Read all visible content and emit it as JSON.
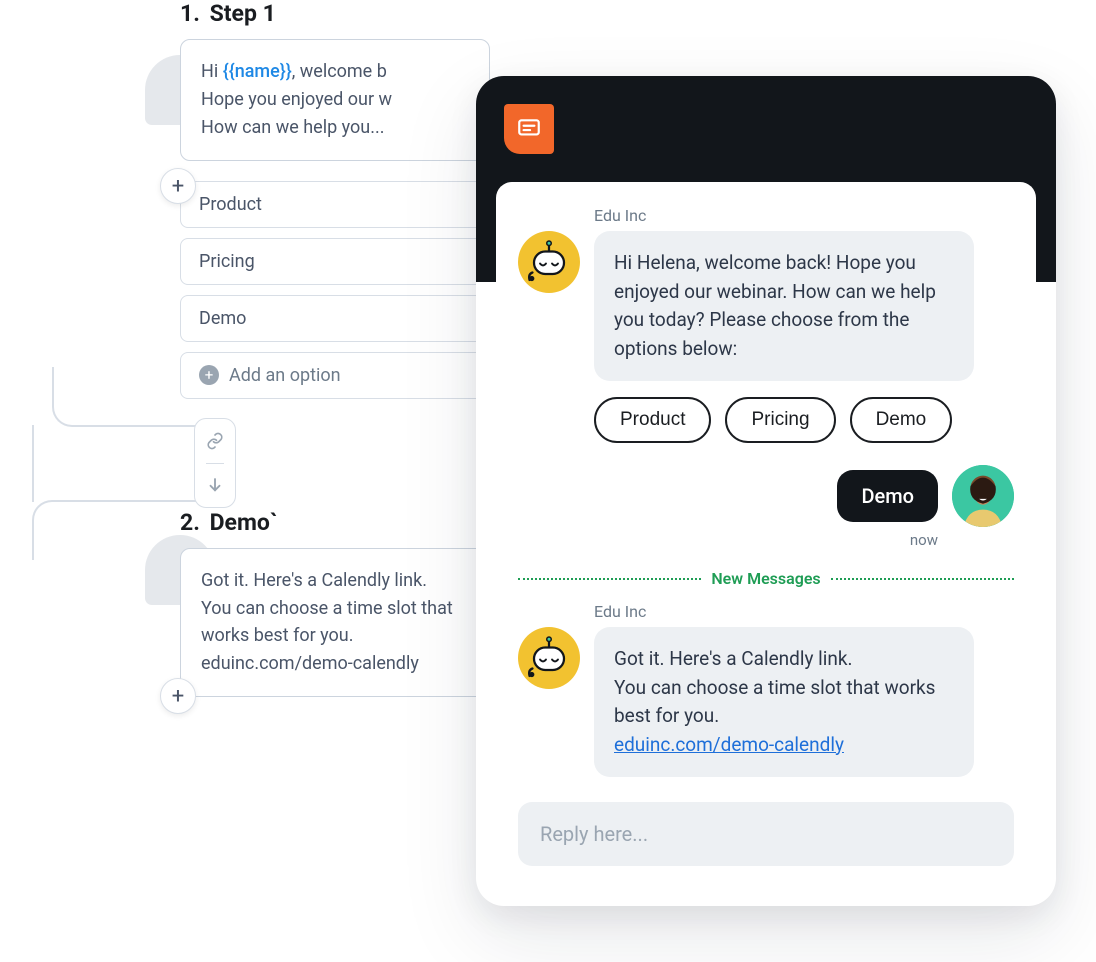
{
  "flow": {
    "step1": {
      "index": "1.",
      "title": "Step 1",
      "message_prefix": "Hi ",
      "message_var": "{{name}}",
      "message_line1_suffix": ", welcome b",
      "message_line2": "Hope you enjoyed our w",
      "message_line3": "How can we help you...",
      "options": [
        "Product",
        "Pricing",
        "Demo"
      ],
      "add_option_label": "Add an option"
    },
    "step2": {
      "index": "2.",
      "title": "Demo`",
      "message_line1": "Got it. Here's a Calendly link.",
      "message_line2": "You can choose a time slot that",
      "message_line3": "works best for you.",
      "message_link": "eduinc.com/demo-calendly"
    }
  },
  "chat": {
    "sender_name": "Edu Inc",
    "bot_message_1": "Hi Helena, welcome back! Hope you enjoyed our webinar. How can we help you today? Please choose from the options below:",
    "chips": [
      "Product",
      "Pricing",
      "Demo"
    ],
    "user_reply": "Demo",
    "user_time": "now",
    "divider_label": "New Messages",
    "bot_message_2_line1": "Got it. Here's a Calendly link.",
    "bot_message_2_line2": "You can choose a time slot that works best for you.",
    "bot_message_2_link": "eduinc.com/demo-calendly",
    "reply_placeholder": "Reply here..."
  }
}
